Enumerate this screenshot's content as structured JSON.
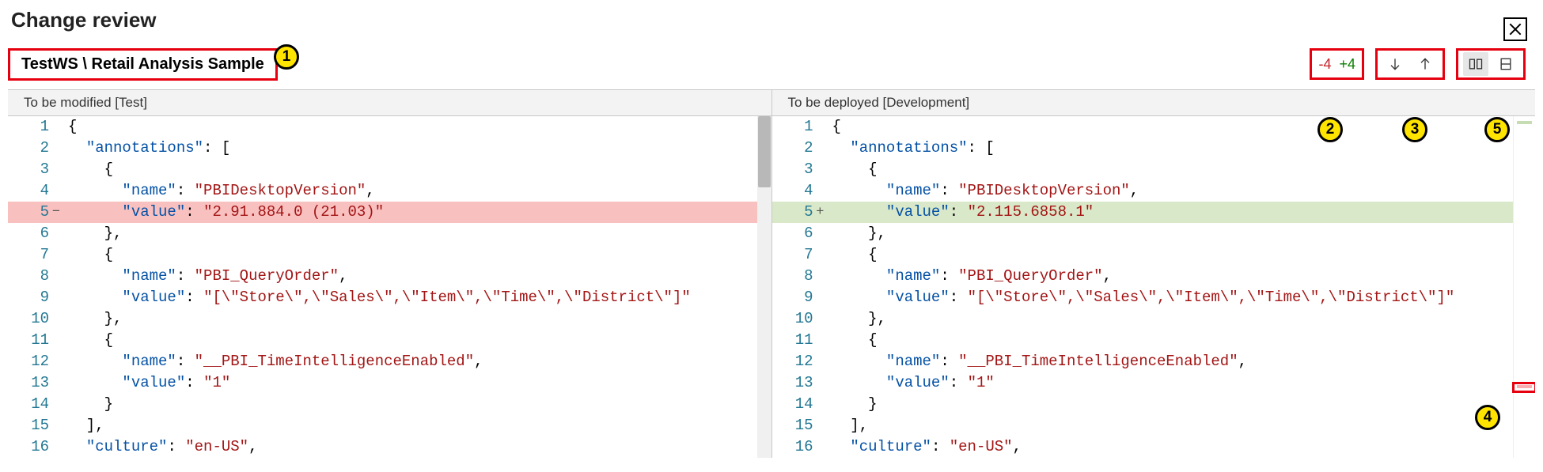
{
  "dialog": {
    "title": "Change review",
    "breadcrumb": "TestWS \\ Retail Analysis Sample",
    "diff_removed": "-4",
    "diff_added": "+4"
  },
  "callouts": {
    "c1": "1",
    "c2": "2",
    "c3": "3",
    "c4": "4",
    "c5": "5"
  },
  "panes": {
    "left_header": "To be modified [Test]",
    "right_header": "To be deployed [Development]"
  },
  "code": {
    "left": {
      "lines": [
        {
          "n": "1",
          "kind": "",
          "tokens": [
            {
              "c": "p",
              "t": "{"
            }
          ]
        },
        {
          "n": "2",
          "kind": "",
          "tokens": [
            {
              "c": "p",
              "t": "  "
            },
            {
              "c": "k",
              "t": "\"annotations\""
            },
            {
              "c": "p",
              "t": ": ["
            }
          ]
        },
        {
          "n": "3",
          "kind": "",
          "tokens": [
            {
              "c": "p",
              "t": "    {"
            }
          ]
        },
        {
          "n": "4",
          "kind": "",
          "tokens": [
            {
              "c": "p",
              "t": "      "
            },
            {
              "c": "k",
              "t": "\"name\""
            },
            {
              "c": "p",
              "t": ": "
            },
            {
              "c": "s",
              "t": "\"PBIDesktopVersion\""
            },
            {
              "c": "p",
              "t": ","
            }
          ]
        },
        {
          "n": "5",
          "kind": "removed",
          "tokens": [
            {
              "c": "p",
              "t": "      "
            },
            {
              "c": "k",
              "t": "\"value\""
            },
            {
              "c": "p",
              "t": ": "
            },
            {
              "c": "s",
              "t": "\"2.91.884.0 (21.03)\""
            }
          ]
        },
        {
          "n": "6",
          "kind": "",
          "tokens": [
            {
              "c": "p",
              "t": "    },"
            }
          ]
        },
        {
          "n": "7",
          "kind": "",
          "tokens": [
            {
              "c": "p",
              "t": "    {"
            }
          ]
        },
        {
          "n": "8",
          "kind": "",
          "tokens": [
            {
              "c": "p",
              "t": "      "
            },
            {
              "c": "k",
              "t": "\"name\""
            },
            {
              "c": "p",
              "t": ": "
            },
            {
              "c": "s",
              "t": "\"PBI_QueryOrder\""
            },
            {
              "c": "p",
              "t": ","
            }
          ]
        },
        {
          "n": "9",
          "kind": "",
          "tokens": [
            {
              "c": "p",
              "t": "      "
            },
            {
              "c": "k",
              "t": "\"value\""
            },
            {
              "c": "p",
              "t": ": "
            },
            {
              "c": "s",
              "t": "\"[\\\"Store\\\",\\\"Sales\\\",\\\"Item\\\",\\\"Time\\\",\\\"District\\\"]\""
            }
          ]
        },
        {
          "n": "10",
          "kind": "",
          "tokens": [
            {
              "c": "p",
              "t": "    },"
            }
          ]
        },
        {
          "n": "11",
          "kind": "",
          "tokens": [
            {
              "c": "p",
              "t": "    {"
            }
          ]
        },
        {
          "n": "12",
          "kind": "",
          "tokens": [
            {
              "c": "p",
              "t": "      "
            },
            {
              "c": "k",
              "t": "\"name\""
            },
            {
              "c": "p",
              "t": ": "
            },
            {
              "c": "s",
              "t": "\"__PBI_TimeIntelligenceEnabled\""
            },
            {
              "c": "p",
              "t": ","
            }
          ]
        },
        {
          "n": "13",
          "kind": "",
          "tokens": [
            {
              "c": "p",
              "t": "      "
            },
            {
              "c": "k",
              "t": "\"value\""
            },
            {
              "c": "p",
              "t": ": "
            },
            {
              "c": "s",
              "t": "\"1\""
            }
          ]
        },
        {
          "n": "14",
          "kind": "",
          "tokens": [
            {
              "c": "p",
              "t": "    }"
            }
          ]
        },
        {
          "n": "15",
          "kind": "",
          "tokens": [
            {
              "c": "p",
              "t": "  ],"
            }
          ]
        },
        {
          "n": "16",
          "kind": "",
          "tokens": [
            {
              "c": "p",
              "t": "  "
            },
            {
              "c": "k",
              "t": "\"culture\""
            },
            {
              "c": "p",
              "t": ": "
            },
            {
              "c": "s",
              "t": "\"en-US\""
            },
            {
              "c": "p",
              "t": ","
            }
          ]
        }
      ]
    },
    "right": {
      "lines": [
        {
          "n": "1",
          "kind": "",
          "tokens": [
            {
              "c": "p",
              "t": "{"
            }
          ]
        },
        {
          "n": "2",
          "kind": "",
          "tokens": [
            {
              "c": "p",
              "t": "  "
            },
            {
              "c": "k",
              "t": "\"annotations\""
            },
            {
              "c": "p",
              "t": ": ["
            }
          ]
        },
        {
          "n": "3",
          "kind": "",
          "tokens": [
            {
              "c": "p",
              "t": "    {"
            }
          ]
        },
        {
          "n": "4",
          "kind": "",
          "tokens": [
            {
              "c": "p",
              "t": "      "
            },
            {
              "c": "k",
              "t": "\"name\""
            },
            {
              "c": "p",
              "t": ": "
            },
            {
              "c": "s",
              "t": "\"PBIDesktopVersion\""
            },
            {
              "c": "p",
              "t": ","
            }
          ]
        },
        {
          "n": "5",
          "kind": "added",
          "tokens": [
            {
              "c": "p",
              "t": "      "
            },
            {
              "c": "k",
              "t": "\"value\""
            },
            {
              "c": "p",
              "t": ": "
            },
            {
              "c": "s",
              "t": "\"2.115.6858.1\""
            }
          ]
        },
        {
          "n": "6",
          "kind": "",
          "tokens": [
            {
              "c": "p",
              "t": "    },"
            }
          ]
        },
        {
          "n": "7",
          "kind": "",
          "tokens": [
            {
              "c": "p",
              "t": "    {"
            }
          ]
        },
        {
          "n": "8",
          "kind": "",
          "tokens": [
            {
              "c": "p",
              "t": "      "
            },
            {
              "c": "k",
              "t": "\"name\""
            },
            {
              "c": "p",
              "t": ": "
            },
            {
              "c": "s",
              "t": "\"PBI_QueryOrder\""
            },
            {
              "c": "p",
              "t": ","
            }
          ]
        },
        {
          "n": "9",
          "kind": "",
          "tokens": [
            {
              "c": "p",
              "t": "      "
            },
            {
              "c": "k",
              "t": "\"value\""
            },
            {
              "c": "p",
              "t": ": "
            },
            {
              "c": "s",
              "t": "\"[\\\"Store\\\",\\\"Sales\\\",\\\"Item\\\",\\\"Time\\\",\\\"District\\\"]\""
            }
          ]
        },
        {
          "n": "10",
          "kind": "",
          "tokens": [
            {
              "c": "p",
              "t": "    },"
            }
          ]
        },
        {
          "n": "11",
          "kind": "",
          "tokens": [
            {
              "c": "p",
              "t": "    {"
            }
          ]
        },
        {
          "n": "12",
          "kind": "",
          "tokens": [
            {
              "c": "p",
              "t": "      "
            },
            {
              "c": "k",
              "t": "\"name\""
            },
            {
              "c": "p",
              "t": ": "
            },
            {
              "c": "s",
              "t": "\"__PBI_TimeIntelligenceEnabled\""
            },
            {
              "c": "p",
              "t": ","
            }
          ]
        },
        {
          "n": "13",
          "kind": "",
          "tokens": [
            {
              "c": "p",
              "t": "      "
            },
            {
              "c": "k",
              "t": "\"value\""
            },
            {
              "c": "p",
              "t": ": "
            },
            {
              "c": "s",
              "t": "\"1\""
            }
          ]
        },
        {
          "n": "14",
          "kind": "",
          "tokens": [
            {
              "c": "p",
              "t": "    }"
            }
          ]
        },
        {
          "n": "15",
          "kind": "",
          "tokens": [
            {
              "c": "p",
              "t": "  ],"
            }
          ]
        },
        {
          "n": "16",
          "kind": "",
          "tokens": [
            {
              "c": "p",
              "t": "  "
            },
            {
              "c": "k",
              "t": "\"culture\""
            },
            {
              "c": "p",
              "t": ": "
            },
            {
              "c": "s",
              "t": "\"en-US\""
            },
            {
              "c": "p",
              "t": ","
            }
          ]
        }
      ]
    }
  }
}
